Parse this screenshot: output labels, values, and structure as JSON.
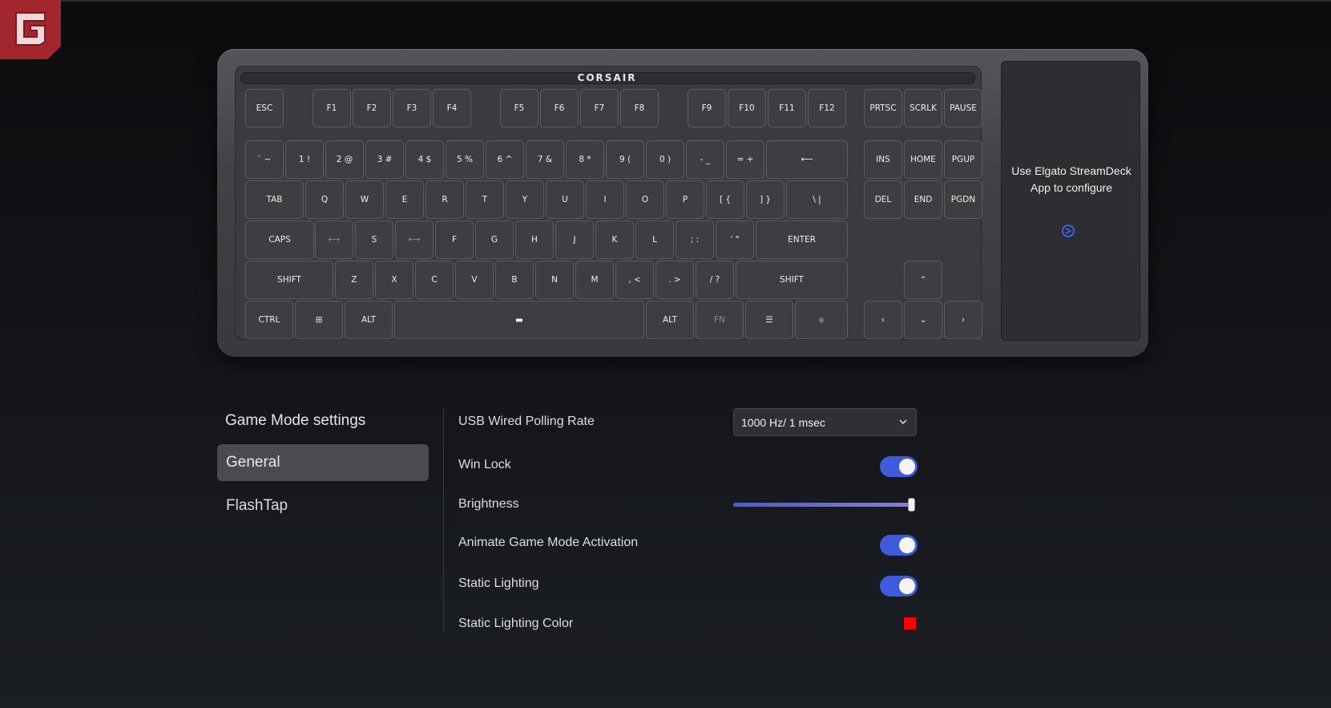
{
  "app": {
    "logo_icon": "g-logo-icon"
  },
  "keyboard": {
    "brand": "CORSAIR",
    "rows": [
      [
        "ESC",
        "F1",
        "F2",
        "F3",
        "F4",
        "F5",
        "F6",
        "F7",
        "F8",
        "F9",
        "F10",
        "F11",
        "F12",
        "PRTSC",
        "SCRLK",
        "PAUSE"
      ],
      [
        "` ~",
        "1 !",
        "2 @",
        "3 #",
        "4 $",
        "5 %",
        "6 ^",
        "7 &",
        "8 *",
        "9 (",
        "0 )",
        "- _",
        "= +",
        "⟵",
        "INS",
        "HOME",
        "PGUP"
      ],
      [
        "TAB",
        "Q",
        "W",
        "E",
        "R",
        "T",
        "Y",
        "U",
        "I",
        "O",
        "P",
        "[ {",
        "] }",
        "\\ |",
        "DEL",
        "END",
        "PGDN"
      ],
      [
        "CAPS",
        "⟷",
        "S",
        "⟷",
        "F",
        "G",
        "H",
        "J",
        "K",
        "L",
        "; :",
        "' \"",
        "ENTER"
      ],
      [
        "SHIFT",
        "Z",
        "X",
        "C",
        "V",
        "B",
        "N",
        "M",
        ", <",
        ". >",
        "/ ?",
        "SHIFT",
        "⌃"
      ],
      [
        "CTRL",
        "⊞",
        "ALT",
        "▬",
        "ALT",
        "FN",
        "☰",
        "◈",
        "‹",
        "⌄",
        "›"
      ]
    ],
    "streamdeck_text": "Use Elgato StreamDeck App to configure",
    "streamdeck_icon": "elgato-icon"
  },
  "sidebar": {
    "title": "Game Mode settings",
    "items": [
      {
        "label": "General",
        "active": true
      },
      {
        "label": "FlashTap",
        "active": false
      }
    ]
  },
  "settings": {
    "polling_label": "USB Wired Polling Rate",
    "polling_value": "1000 Hz/ 1 msec",
    "winlock_label": "Win Lock",
    "winlock_on": true,
    "brightness_label": "Brightness",
    "brightness_value": 1.0,
    "animate_label": "Animate Game Mode Activation",
    "animate_on": true,
    "static_label": "Static Lighting",
    "static_on": true,
    "color_label": "Static Lighting Color",
    "color_value": "#ff0000",
    "accent_color": "#3d5bdb"
  }
}
